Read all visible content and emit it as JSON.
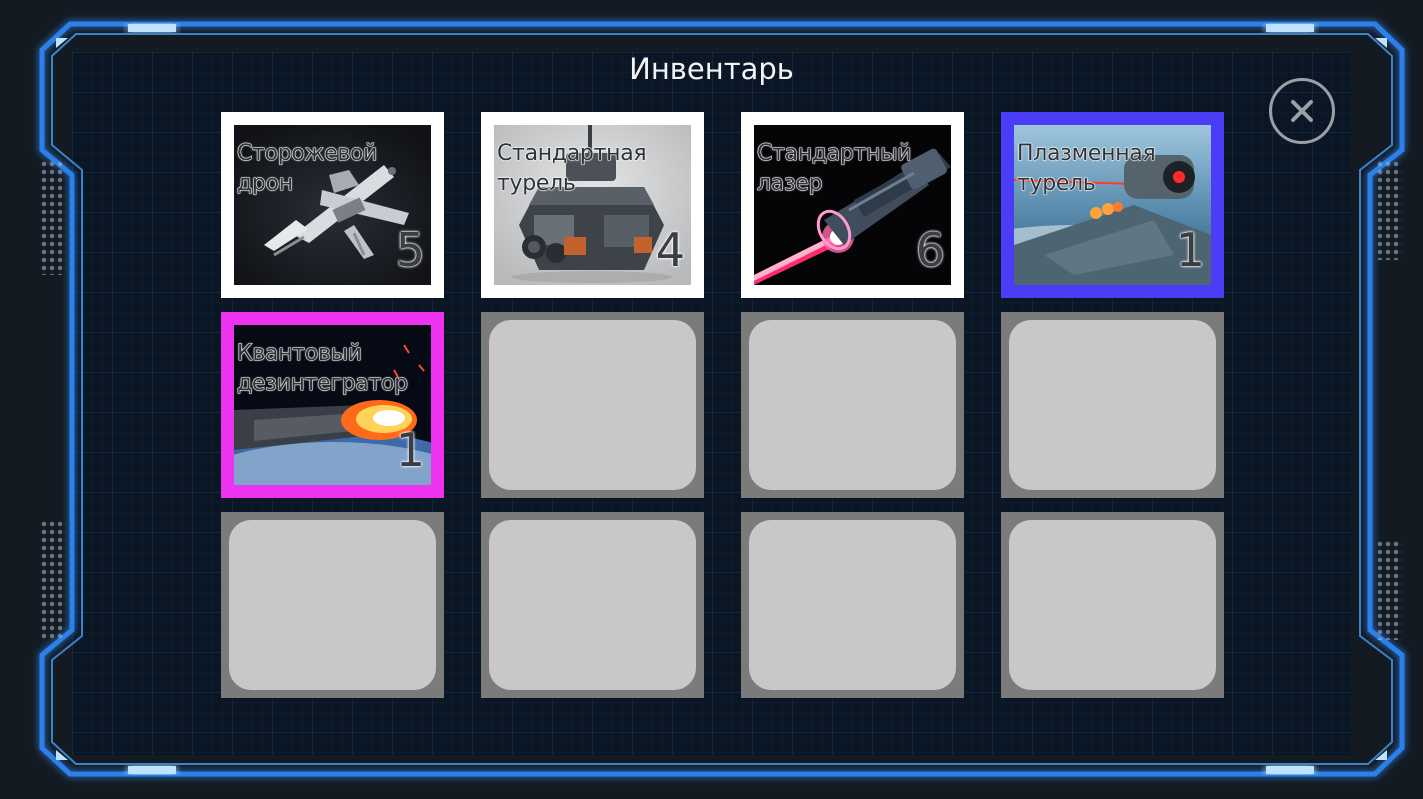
{
  "window": {
    "title": "Инвентарь"
  },
  "close_button": {
    "icon": "close-icon"
  },
  "colors": {
    "frame_glow": "#2f8dff",
    "frame_line": "#9fd4ff",
    "panel_bg": "#0b1624",
    "rarity_common": "#ffffff",
    "rarity_rare": "#4a3cf7",
    "rarity_epic": "#ee33f0",
    "empty_slot": "#7b7b7b",
    "empty_slot_inner": "#c9c7ca"
  },
  "inventory": {
    "slots": [
      {
        "name": "Сторожевой дрон",
        "count": "5",
        "art": "drone",
        "rarity_color": "#ffffff"
      },
      {
        "name": "Стандартная турель",
        "count": "4",
        "art": "turret",
        "rarity_color": "#ffffff"
      },
      {
        "name": "Стандартный лазер",
        "count": "6",
        "art": "laser",
        "rarity_color": "#ffffff"
      },
      {
        "name": "Плазменная турель",
        "count": "1",
        "art": "plasma",
        "rarity_color": "#4a3cf7"
      },
      {
        "name": "Квантовый дезинтегратор",
        "count": "1",
        "art": "quantum",
        "rarity_color": "#ee33f0"
      },
      null,
      null,
      null,
      null,
      null,
      null,
      null
    ]
  }
}
